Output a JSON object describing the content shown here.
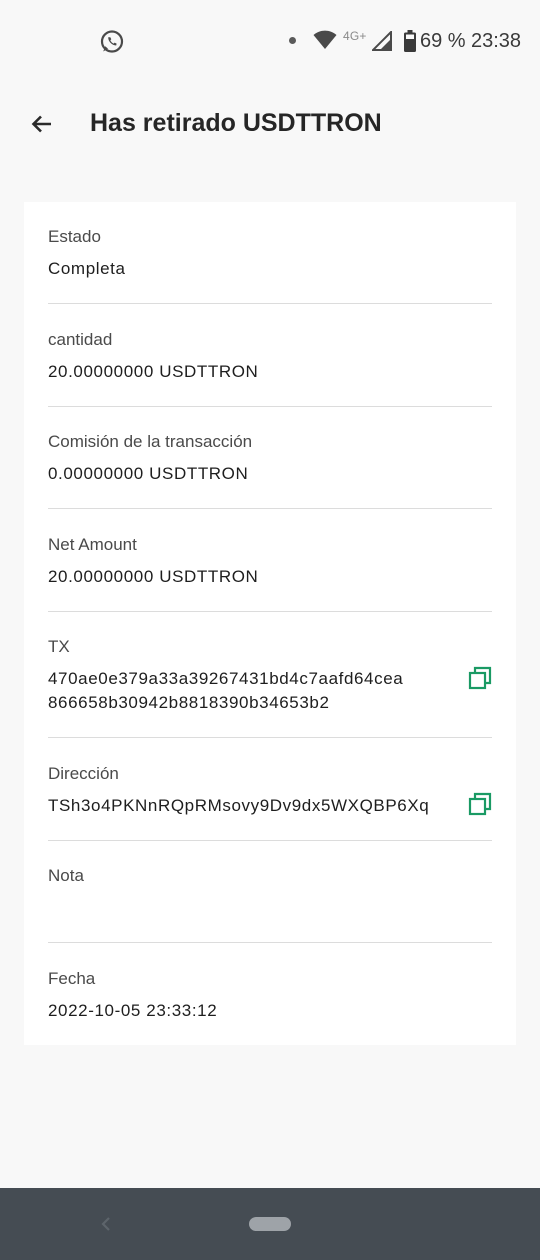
{
  "status_bar": {
    "network": "4G+",
    "battery": "69 %",
    "time": "23:38",
    "icons": [
      "whatsapp-icon",
      "notification-dot-icon",
      "wifi-icon",
      "signal-icon",
      "battery-icon"
    ]
  },
  "header": {
    "title": "Has retirado USDTTRON",
    "back_icon": "arrow-left-icon"
  },
  "details": [
    {
      "label": "Estado",
      "value": "Completa"
    },
    {
      "label": "cantidad",
      "value": "20.00000000 USDTTRON"
    },
    {
      "label": "Comisión de la transacción",
      "value": "0.00000000 USDTTRON"
    },
    {
      "label": "Net Amount",
      "value": "20.00000000 USDTTRON"
    },
    {
      "label": "TX",
      "value_line1": "470ae0e379a33a39267431bd4c7aafd64cea",
      "value_line2": "866658b30942b8818390b34653b2"
    },
    {
      "label": "Dirección",
      "value": "TSh3o4PKNnRQpRMsovy9Dv9dx5WXQBP6Xq"
    },
    {
      "label": "Nota",
      "value": ""
    },
    {
      "label": "Fecha",
      "value": "2022-10-05 23:33:12"
    }
  ],
  "colors": {
    "background": "#f8f8f8",
    "card": "#ffffff",
    "accent": "#1a9a64",
    "nav_bar": "#454c53"
  }
}
